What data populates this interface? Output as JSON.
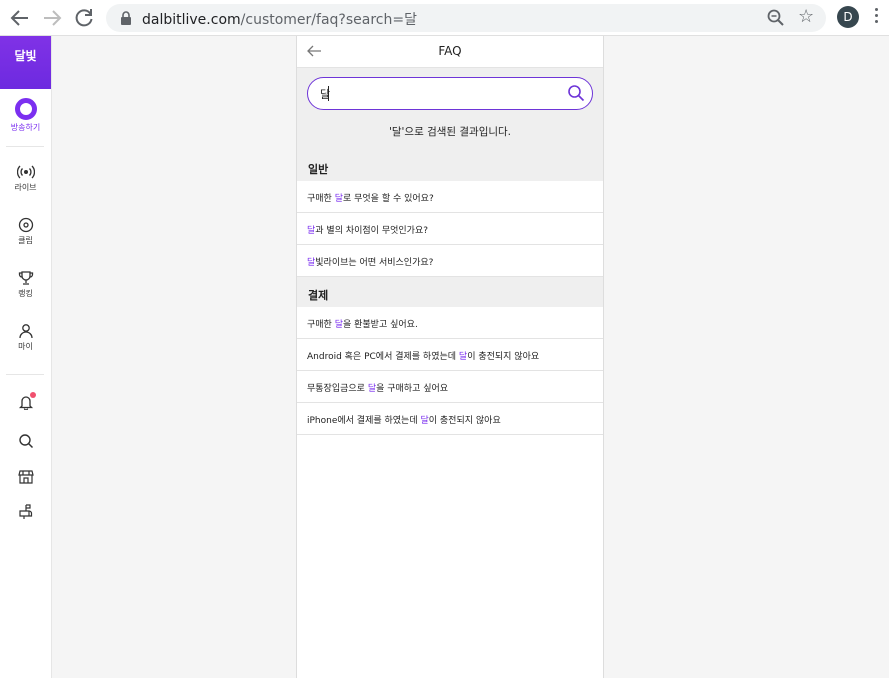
{
  "browser": {
    "url_host": "dalbitlive.com",
    "url_path": "/customer/faq?search=달",
    "avatar_letter": "D"
  },
  "sidebar": {
    "logo": "달빛",
    "broadcast_label": "방송하기",
    "items": [
      {
        "label": "라이브",
        "icon": "live-radio-icon"
      },
      {
        "label": "클립",
        "icon": "clip-disc-icon"
      },
      {
        "label": "랭킹",
        "icon": "trophy-icon"
      },
      {
        "label": "마이",
        "icon": "person-icon"
      }
    ],
    "bottom_icons": [
      "notification-bell-icon",
      "search-icon",
      "store-icon",
      "mailbox-icon"
    ]
  },
  "faq": {
    "title": "FAQ",
    "search_value": "달",
    "result_quote": "'달'",
    "result_rest": "으로 검색된 결과입니다.",
    "highlight_color": "#7b2ff0",
    "categories": [
      {
        "name": "일반",
        "items": [
          {
            "pre": "구매한 ",
            "hl": "달",
            "post": "로 무엇을 할 수 있어요?"
          },
          {
            "pre": "",
            "hl": "달",
            "post": "과 별의 차이점이 무엇인가요?"
          },
          {
            "pre": "",
            "hl": "달",
            "post": "빛라이브는 어떤 서비스인가요?"
          }
        ]
      },
      {
        "name": "결제",
        "items": [
          {
            "pre": "구매한 ",
            "hl": "달",
            "post": "을 환불받고 싶어요."
          },
          {
            "pre": "Android 혹은 PC에서 결제를 하였는데 ",
            "hl": "달",
            "post": "이 충전되지 않아요"
          },
          {
            "pre": "무통장입금으로 ",
            "hl": "달",
            "post": "을 구매하고 싶어요"
          },
          {
            "pre": "iPhone에서 결제를 하였는데 ",
            "hl": "달",
            "post": "이 충전되지 않아요"
          }
        ]
      }
    ]
  }
}
